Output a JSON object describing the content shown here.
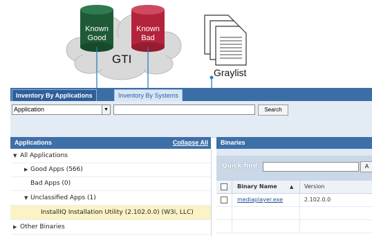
{
  "diagram": {
    "known_good": {
      "line1": "Known",
      "line2": "Good",
      "color": "#1e5a36"
    },
    "known_bad": {
      "line1": "Known",
      "line2": "Bad",
      "color": "#b3243c"
    },
    "gti_label": "GTI",
    "graylist_label": "Graylist",
    "connector_color": "#2a7fc0"
  },
  "tabs": [
    {
      "label": "Inventory By Applications"
    },
    {
      "label": "Inventory By Systems"
    }
  ],
  "toolbar": {
    "select_value": "Application",
    "search_button": "Search"
  },
  "applications": {
    "title": "Applications",
    "collapse_all": "Collapse All",
    "tree": [
      {
        "label": "All Applications"
      },
      {
        "label": "Good Apps (566)"
      },
      {
        "label": "Bad Apps (0)"
      },
      {
        "label": "Unclassified Apps (1)"
      },
      {
        "label": "InstallIQ Installation Utility (2.102.0.0) (W3i, LLC)"
      },
      {
        "label": "Other Binaries"
      }
    ]
  },
  "binaries": {
    "title": "Binaries",
    "quick_find_label": "Quick find:",
    "quick_find_button": "A",
    "columns": [
      "Binary Name",
      "Version"
    ],
    "rows": [
      {
        "name": "mediaplayer.exe",
        "version": "2.102.0.0"
      }
    ]
  }
}
